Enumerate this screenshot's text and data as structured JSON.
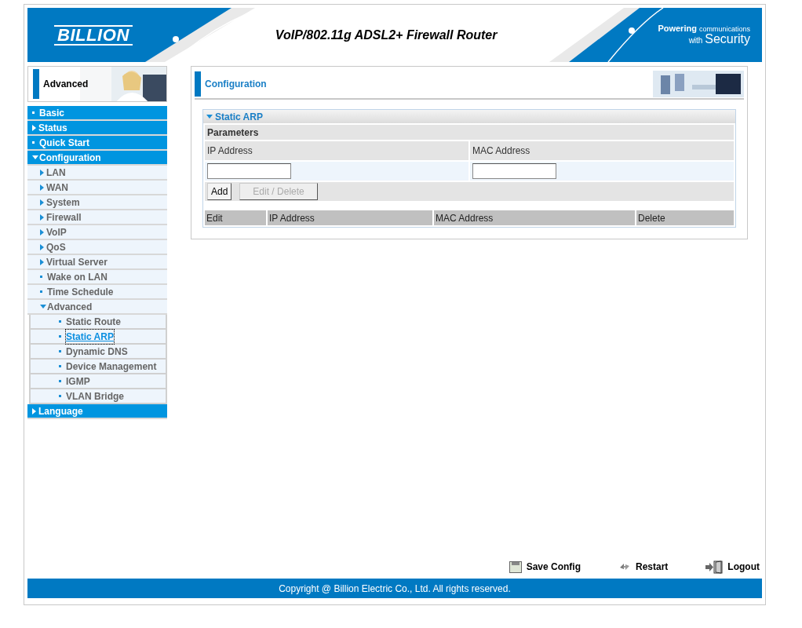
{
  "header": {
    "logo": "BILLION",
    "title": "VoIP/802.11g ADSL2+ Firewall Router",
    "tagline_top": "Powering",
    "tagline_small": "communications",
    "tagline_with": "with",
    "tagline_big": "Security"
  },
  "sidebar": {
    "title": "Advanced",
    "menu": [
      {
        "label": "Basic",
        "kind": "page",
        "selected": false
      },
      {
        "label": "Status",
        "kind": "group",
        "expanded": false
      },
      {
        "label": "Quick Start",
        "kind": "page",
        "selected": false
      },
      {
        "label": "Configuration",
        "kind": "group",
        "expanded": true,
        "children": [
          {
            "label": "LAN",
            "kind": "group",
            "expanded": false
          },
          {
            "label": "WAN",
            "kind": "group",
            "expanded": false
          },
          {
            "label": "System",
            "kind": "group",
            "expanded": false
          },
          {
            "label": "Firewall",
            "kind": "group",
            "expanded": false
          },
          {
            "label": "VoIP",
            "kind": "group",
            "expanded": false
          },
          {
            "label": "QoS",
            "kind": "group",
            "expanded": false
          },
          {
            "label": "Virtual Server",
            "kind": "group",
            "expanded": false
          },
          {
            "label": "Wake on LAN",
            "kind": "page",
            "selected": false
          },
          {
            "label": "Time Schedule",
            "kind": "page",
            "selected": false
          },
          {
            "label": "Advanced",
            "kind": "group",
            "expanded": true,
            "children": [
              {
                "label": "Static Route",
                "kind": "page",
                "selected": false
              },
              {
                "label": "Static ARP",
                "kind": "page",
                "selected": true
              },
              {
                "label": "Dynamic DNS",
                "kind": "page",
                "selected": false
              },
              {
                "label": "Device Management",
                "kind": "page",
                "selected": false
              },
              {
                "label": "IGMP",
                "kind": "page",
                "selected": false
              },
              {
                "label": "VLAN Bridge",
                "kind": "page",
                "selected": false
              }
            ]
          }
        ]
      },
      {
        "label": "Language",
        "kind": "group",
        "expanded": false
      }
    ]
  },
  "panel": {
    "title": "Configuration",
    "section": {
      "title": "Static ARP",
      "expanded": true,
      "subtitle": "Parameters",
      "fields": [
        {
          "label": "IP Address"
        },
        {
          "label": "MAC Address"
        }
      ],
      "buttons": [
        {
          "label": "Add",
          "disabled": false
        },
        {
          "label": "Edit / Delete",
          "disabled": true
        }
      ],
      "table": {
        "columns": [
          "Edit",
          "IP Address",
          "MAC Address",
          "Delete"
        ]
      }
    }
  },
  "actions": [
    {
      "label": "Save Config",
      "kind": "save"
    },
    {
      "label": "Restart",
      "kind": "restart"
    },
    {
      "label": "Logout",
      "kind": "logout"
    }
  ],
  "footer": "Copyright @ Billion Electric Co., Ltd. All rights reserved."
}
